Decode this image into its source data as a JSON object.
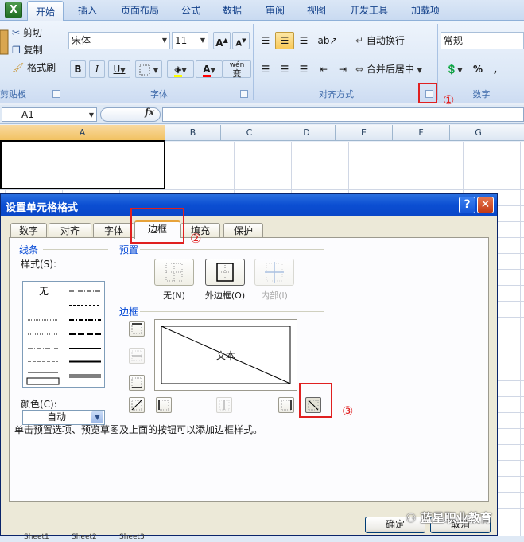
{
  "app_icon": "X",
  "ribbon": {
    "tabs": [
      "开始",
      "插入",
      "页面布局",
      "公式",
      "数据",
      "审阅",
      "视图",
      "开发工具",
      "加载项"
    ],
    "active_tab": "开始",
    "clipboard": {
      "cut": "剪切",
      "copy": "复制",
      "format_painter": "格式刷",
      "group_label": "剪贴板"
    },
    "font": {
      "name": "宋体",
      "size": "11",
      "grow": "A",
      "shrink": "A",
      "bold": "B",
      "italic": "I",
      "underline": "U",
      "font_color_glyph": "A",
      "wen": "wén",
      "wen_char": "变",
      "group_label": "字体"
    },
    "align": {
      "wrap": "自动换行",
      "merge": "合并后居中",
      "group_label": "对齐方式"
    },
    "number": {
      "format": "常规",
      "percent": "%",
      "comma": ",",
      "group_label": "数字"
    }
  },
  "formula_bar": {
    "cell_ref": "A1",
    "fx": "fx"
  },
  "columns": [
    "A",
    "B",
    "C",
    "D",
    "E",
    "F",
    "G"
  ],
  "dialog": {
    "title": "设置单元格格式",
    "help": "?",
    "close": "✕",
    "tabs": [
      "数字",
      "对齐",
      "字体",
      "边框",
      "填充",
      "保护"
    ],
    "active_tab": "边框",
    "line_group": "线条",
    "style_label": "样式(S):",
    "style_none": "无",
    "color_label": "颜色(C):",
    "color_value": "自动",
    "preset_group": "预置",
    "presets": [
      "无(N)",
      "外边框(O)",
      "内部(I)"
    ],
    "border_group": "边框",
    "preview_text": "文本",
    "hint": "单击预置选项、预览草图及上面的按钮可以添加边框样式。",
    "ok": "确定",
    "cancel": "取消"
  },
  "annotations": [
    "①",
    "②",
    "③"
  ],
  "sheet_tabs": [
    "Sheet1",
    "Sheet2",
    "Sheet3"
  ],
  "watermark": "蓝星职业教育",
  "colors": {
    "ribbon": "#dbe7f6",
    "dialog_title": "#0b4ed2",
    "annotation": "#e02020",
    "tab_highlight": "#e7a23a"
  }
}
